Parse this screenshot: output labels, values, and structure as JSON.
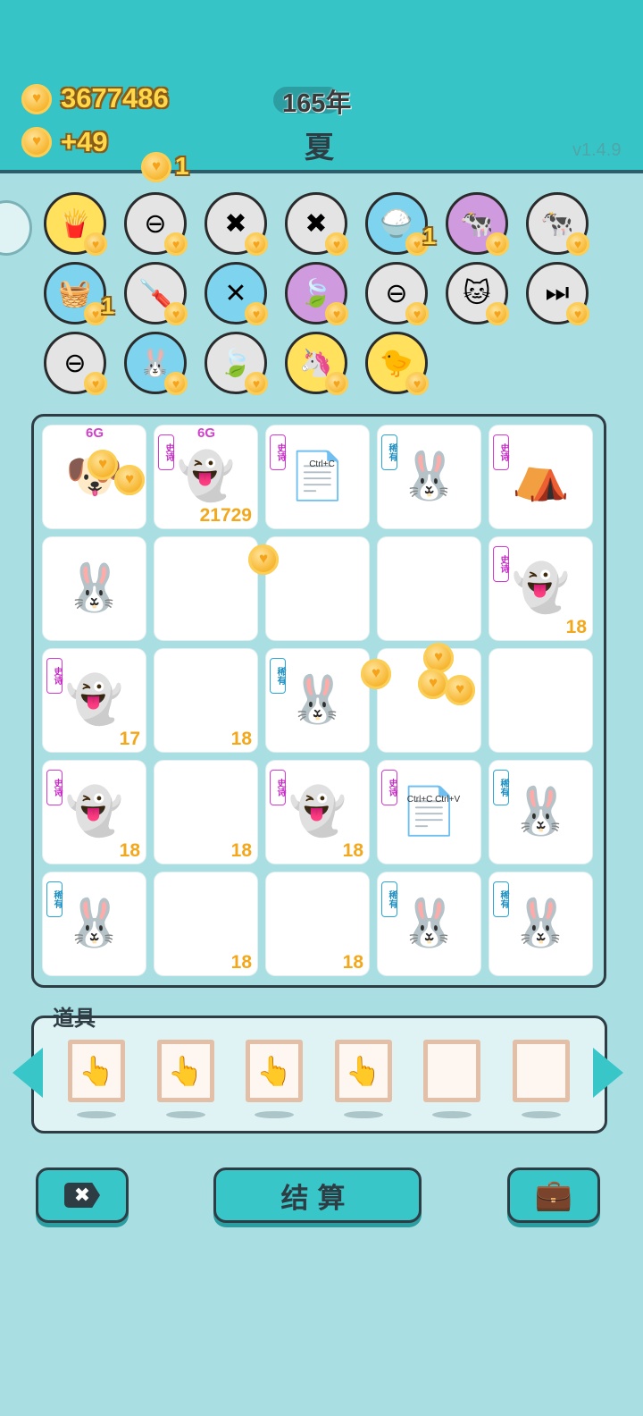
{
  "header": {
    "coins": "3677486",
    "coin_gain": "+49",
    "year": "165年",
    "season": "夏",
    "version": "v1.4.9",
    "floating_reward": "1"
  },
  "items": [
    {
      "icon": "fries-icon",
      "glyph": "🍟",
      "bg": "#ffe15e"
    },
    {
      "icon": "remove-icon",
      "glyph": "⊖",
      "bg": "#e4e4e4"
    },
    {
      "icon": "delete-tag-icon",
      "glyph": "✖",
      "bg": "#e4e4e4"
    },
    {
      "icon": "delete-tag-icon",
      "glyph": "✖",
      "bg": "#e4e4e4"
    },
    {
      "icon": "rice-bowl-icon",
      "glyph": "🍚",
      "bg": "#7ed3ee",
      "count": "1"
    },
    {
      "icon": "dairy-cows-icon",
      "glyph": "🐄",
      "bg": "#d09ade"
    },
    {
      "icon": "dairy-cows-icon",
      "glyph": "🐄",
      "bg": "#e4e4e4"
    },
    {
      "icon": "basket-icon",
      "glyph": "🧺",
      "bg": "#7ed3ee",
      "count": "1"
    },
    {
      "icon": "screwdriver-icon",
      "glyph": "🪛",
      "bg": "#e4e4e4"
    },
    {
      "icon": "chopsticks-icon",
      "glyph": "✕",
      "bg": "#7ed3ee"
    },
    {
      "icon": "leaf-icon",
      "glyph": "🍃",
      "bg": "#d09ade"
    },
    {
      "icon": "remove-icon",
      "glyph": "⊖",
      "bg": "#e4e4e4"
    },
    {
      "icon": "cat-masks-icon",
      "glyph": "🐱",
      "bg": "#e4e4e4"
    },
    {
      "icon": "skip-icon",
      "glyph": "⏭",
      "bg": "#e4e4e4"
    },
    {
      "icon": "remove-icon",
      "glyph": "⊖",
      "bg": "#e4e4e4"
    },
    {
      "icon": "rabbit-icon",
      "glyph": "🐰",
      "bg": "#7ed3ee"
    },
    {
      "icon": "leaf-icon",
      "glyph": "🍃",
      "bg": "#e4e4e4"
    },
    {
      "icon": "unicorn-icon",
      "glyph": "🦄",
      "bg": "#ffe15e"
    },
    {
      "icon": "chick-icon",
      "glyph": "🐤",
      "bg": "#ffe15e"
    }
  ],
  "board": [
    {
      "name": "dog",
      "glyph": "🐶",
      "tag": "",
      "value": "",
      "label": "6G"
    },
    {
      "name": "ghost",
      "glyph": "👻",
      "tag": "史诗",
      "tagColor": "purple",
      "value": "21729",
      "label": "6G"
    },
    {
      "name": "copy-card",
      "glyph": "📄",
      "tag": "史诗",
      "tagColor": "purple",
      "value": "",
      "cardText": "Ctrl+C"
    },
    {
      "name": "rabbit",
      "glyph": "🐰",
      "tag": "稀有",
      "tagColor": "blue",
      "value": ""
    },
    {
      "name": "rabbit-tent",
      "glyph": "⛺",
      "tag": "史诗",
      "tagColor": "purple",
      "value": ""
    },
    {
      "name": "rabbit",
      "glyph": "🐰",
      "tag": "",
      "value": ""
    },
    {
      "name": "empty",
      "glyph": "",
      "tag": "",
      "value": ""
    },
    {
      "name": "empty",
      "glyph": "",
      "tag": "",
      "value": ""
    },
    {
      "name": "empty",
      "glyph": "",
      "tag": "",
      "value": ""
    },
    {
      "name": "ghost",
      "glyph": "👻",
      "tag": "史诗",
      "tagColor": "purple",
      "value": "18"
    },
    {
      "name": "ghost",
      "glyph": "👻",
      "tag": "史诗",
      "tagColor": "purple",
      "value": "17"
    },
    {
      "name": "empty",
      "glyph": "",
      "tag": "",
      "value": "18"
    },
    {
      "name": "rabbit",
      "glyph": "🐰",
      "tag": "稀有",
      "tagColor": "blue",
      "value": ""
    },
    {
      "name": "empty",
      "glyph": "",
      "tag": "",
      "value": ""
    },
    {
      "name": "empty",
      "glyph": "",
      "tag": "",
      "value": ""
    },
    {
      "name": "ghost",
      "glyph": "👻",
      "tag": "史诗",
      "tagColor": "purple",
      "value": "18"
    },
    {
      "name": "empty",
      "glyph": "",
      "tag": "",
      "value": "18"
    },
    {
      "name": "ghost",
      "glyph": "👻",
      "tag": "史诗",
      "tagColor": "purple",
      "value": "18"
    },
    {
      "name": "paste-card",
      "glyph": "📄",
      "tag": "史诗",
      "tagColor": "purple",
      "value": "",
      "cardText": "Ctrl+C Ctrl+V"
    },
    {
      "name": "rabbit",
      "glyph": "🐰",
      "tag": "稀有",
      "tagColor": "blue",
      "value": ""
    },
    {
      "name": "rabbit",
      "glyph": "🐰",
      "tag": "稀有",
      "tagColor": "blue",
      "value": ""
    },
    {
      "name": "empty",
      "glyph": "",
      "tag": "",
      "value": "18"
    },
    {
      "name": "empty",
      "glyph": "",
      "tag": "",
      "value": "18"
    },
    {
      "name": "rabbit",
      "glyph": "🐰",
      "tag": "稀有",
      "tagColor": "blue",
      "value": ""
    },
    {
      "name": "rabbit",
      "glyph": "🐰",
      "tag": "稀有",
      "tagColor": "blue",
      "value": ""
    }
  ],
  "props": {
    "title": "道具",
    "slots": [
      {
        "icon": "pointing-hand-icon",
        "glyph": "👆"
      },
      {
        "icon": "pointing-hand-icon",
        "glyph": "👆"
      },
      {
        "icon": "pointing-hand-icon",
        "glyph": "👆"
      },
      {
        "icon": "pointing-hand-icon",
        "glyph": "👆"
      },
      {
        "icon": "empty-slot",
        "glyph": ""
      },
      {
        "icon": "empty-slot",
        "glyph": ""
      }
    ]
  },
  "footer": {
    "settle_label": "结算",
    "remove_icon": "delete-tag-icon",
    "bag_icon": "briefcase-icon"
  },
  "colors": {
    "accent": "#38c6c9",
    "header": "#37c4c6",
    "background": "#a9dfe3",
    "gold": "#ffd84a",
    "epic_tag": "#d23ad2",
    "rare_tag": "#2aa6d6"
  }
}
